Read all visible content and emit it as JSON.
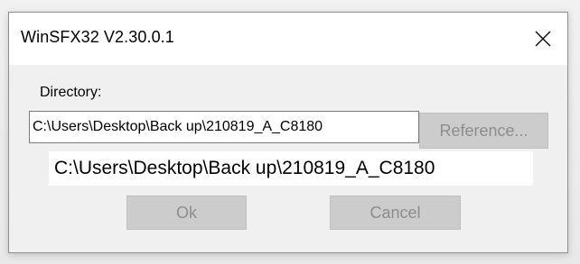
{
  "window": {
    "title": "WinSFX32 V2.30.0.1",
    "close_icon": "close-icon"
  },
  "form": {
    "directory_label": "Directory:",
    "directory_value": "C:\\Users\\Desktop\\Back up\\210819_A_C8180",
    "reference_button": "Reference...",
    "path_display": "C:\\Users\\Desktop\\Back up\\210819_A_C8180"
  },
  "actions": {
    "ok_label": "Ok",
    "cancel_label": "Cancel"
  },
  "colors": {
    "disabled_button_bg": "#cccccc",
    "disabled_button_text": "#8d8d8d",
    "titlebar_bg": "#ffffff",
    "dialog_bg": "#f0f0f0"
  }
}
